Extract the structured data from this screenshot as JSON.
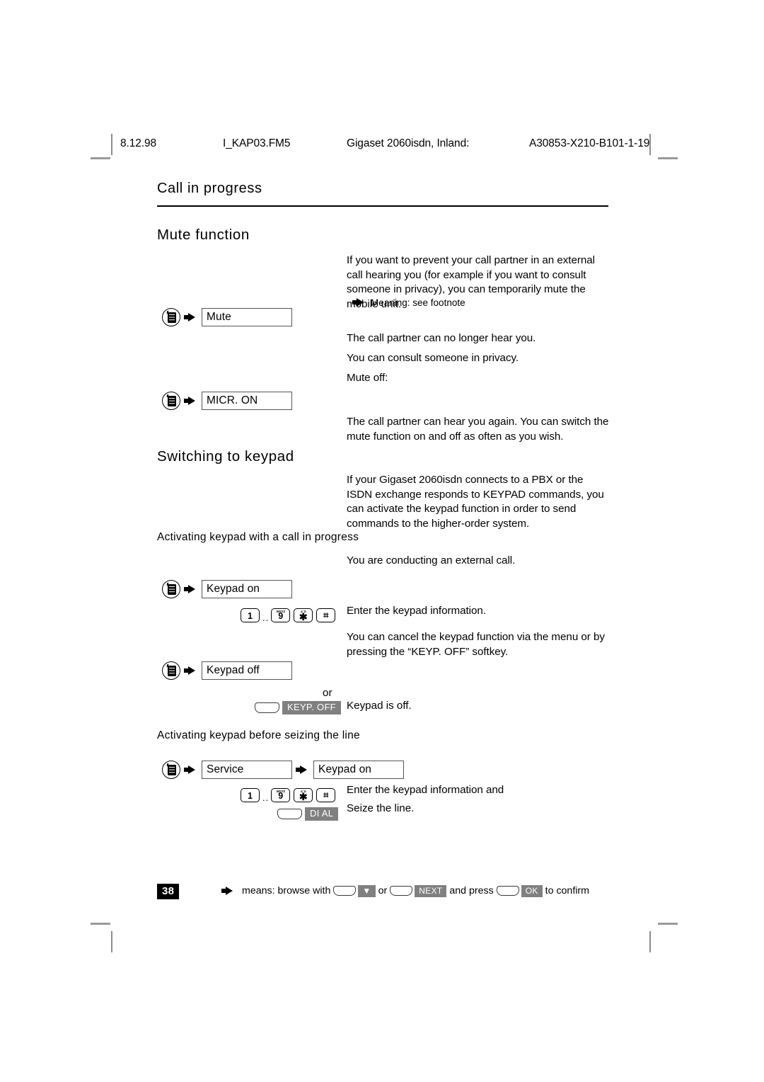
{
  "running_header": {
    "date": "8.12.98",
    "file": "I_KAP03.FM5",
    "title": "Gigaset 2060isdn, Inland:",
    "code": "A30853-X210-B101-1-19"
  },
  "chapter_title": "Call in progress",
  "sections": {
    "mute": {
      "heading": "Mute function",
      "intro": "If you want to prevent your call partner in an external call hearing you (for example if you want to consult someone in privacy), you can temporarily mute the mobile unit.",
      "footnote_hint": "Meaning: see footnote",
      "step_mute_label": "Mute",
      "after_mute_1": "The call partner can no longer hear you.",
      "after_mute_2": "You can consult someone in privacy.",
      "mute_off_label": "Mute off:",
      "step_micr_on_label": "MICR. ON",
      "after_micr_on": "The call partner can hear you again. You can switch the mute function on and off as often as you wish."
    },
    "keypad": {
      "heading": "Switching to keypad",
      "intro": "If your Gigaset 2060isdn connects to a PBX or the ISDN exchange responds to KEYPAD commands, you can activate the keypad function in order to send commands to the higher-order system.",
      "sub1_heading": "Activating keypad with a call in progress",
      "sub1_precondition": "You are conducting an external call.",
      "step_keypad_on_label": "Keypad on",
      "enter_keypad_info": "Enter the keypad information.",
      "cancel_text": "You can cancel the keypad function via the menu or by pressing the “KEYP. OFF” softkey.",
      "step_keypad_off_label": "Keypad off",
      "or_word": "or",
      "softkey_keyp_off": "KEYP.  OFF",
      "keypad_is_off": "Keypad is off.",
      "sub2_heading": "Activating keypad before seizing the line",
      "step_service_label": "Service",
      "step_keypad_on_label2": "Keypad on",
      "enter_keypad_info_and": "Enter the keypad information and",
      "softkey_dial": "DI AL",
      "seize_the_line": "Seize the line."
    }
  },
  "keypad_keys": {
    "key_1": {
      "digit": "1",
      "label": ""
    },
    "ellipsis": "..",
    "key_9": {
      "digit": "9",
      "label": "WXYZ"
    },
    "key_star": {
      "digit": "✱",
      "label": "a¨¨ä"
    },
    "key_hash": {
      "digit": "⌗",
      "label": ""
    }
  },
  "footer": {
    "page_number": "38",
    "legend_means": "means: browse with",
    "legend_or": "or",
    "legend_next": "NEXT",
    "legend_and_press": "and press",
    "legend_ok": "OK",
    "legend_confirm": "to confirm",
    "legend_down_arrow": "▼"
  }
}
